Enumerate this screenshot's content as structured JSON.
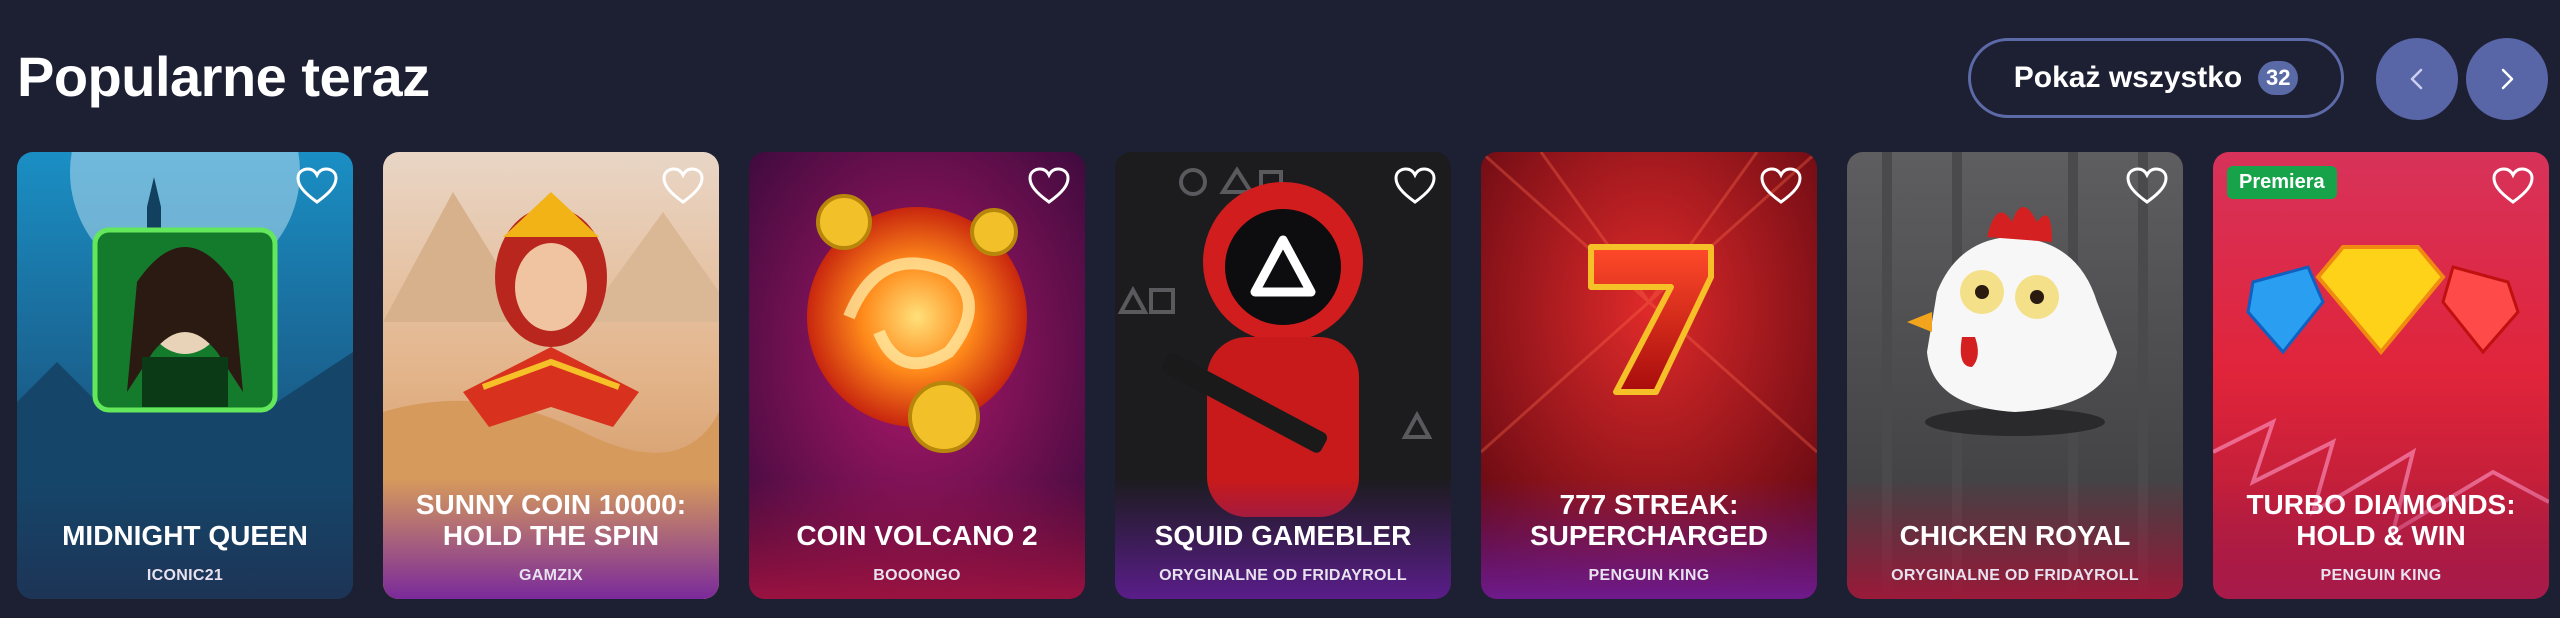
{
  "section": {
    "title": "Popularne teraz",
    "show_all_label": "Pokaż wszystko",
    "show_all_count": "32"
  },
  "navigation": {
    "prev_icon": "chevron-left-icon",
    "next_icon": "chevron-right-icon",
    "button_color": "#5865a6"
  },
  "games": [
    {
      "name": "MIDNIGHT QUEEN",
      "provider": "ICONIC21",
      "badge": "",
      "theme": "night-castle"
    },
    {
      "name": "SUNNY COIN 10000: HOLD THE SPIN",
      "provider": "GAMZIX",
      "badge": "",
      "theme": "desert-pyramids"
    },
    {
      "name": "COIN VOLCANO 2",
      "provider": "BOOONGO",
      "badge": "",
      "theme": "fire-vortex"
    },
    {
      "name": "SQUID GAMEBLER",
      "provider": "ORYGINALNE OD FRIDAYROLL",
      "badge": "",
      "theme": "squid-guard"
    },
    {
      "name": "777 STREAK: SUPERCHARGED",
      "provider": "PENGUIN KING",
      "badge": "",
      "theme": "red-seven"
    },
    {
      "name": "CHICKEN ROYAL",
      "provider": "ORYGINALNE OD FRIDAYROLL",
      "badge": "",
      "theme": "chicken"
    },
    {
      "name": "TURBO DIAMONDS: HOLD & WIN",
      "provider": "PENGUIN KING",
      "badge": "Premiera",
      "theme": "diamonds"
    }
  ],
  "colors": {
    "background": "#1d1f33",
    "accent": "#5865a6",
    "new_badge": "#16a34a"
  }
}
